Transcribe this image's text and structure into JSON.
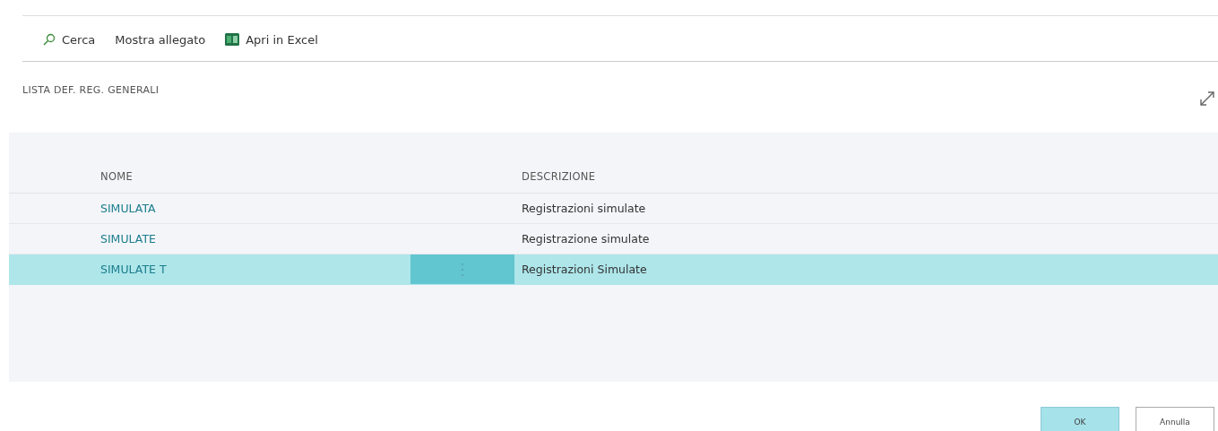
{
  "toolbar": [
    {
      "kind": "search",
      "label": "Cerca"
    },
    {
      "kind": "plain",
      "label": "Mostra allegato"
    },
    {
      "kind": "excel",
      "label": "Apri in Excel"
    }
  ],
  "title": "LISTA DEF. REG. GENERALI",
  "table": {
    "columns": [
      "NOME",
      "DESCRIZIONE"
    ],
    "rows": [
      {
        "name": "SIMULATA",
        "description": "Registrazioni simulate",
        "selected": false
      },
      {
        "name": "SIMULATE",
        "description": "Registrazione simulate",
        "selected": false
      },
      {
        "name": "SIMULATE T",
        "description": "Registrazioni Simulate",
        "selected": true
      }
    ]
  },
  "buttons": [
    {
      "label": "OK",
      "kind": "primary"
    },
    {
      "label": "Annulla",
      "kind": "secondary"
    }
  ]
}
